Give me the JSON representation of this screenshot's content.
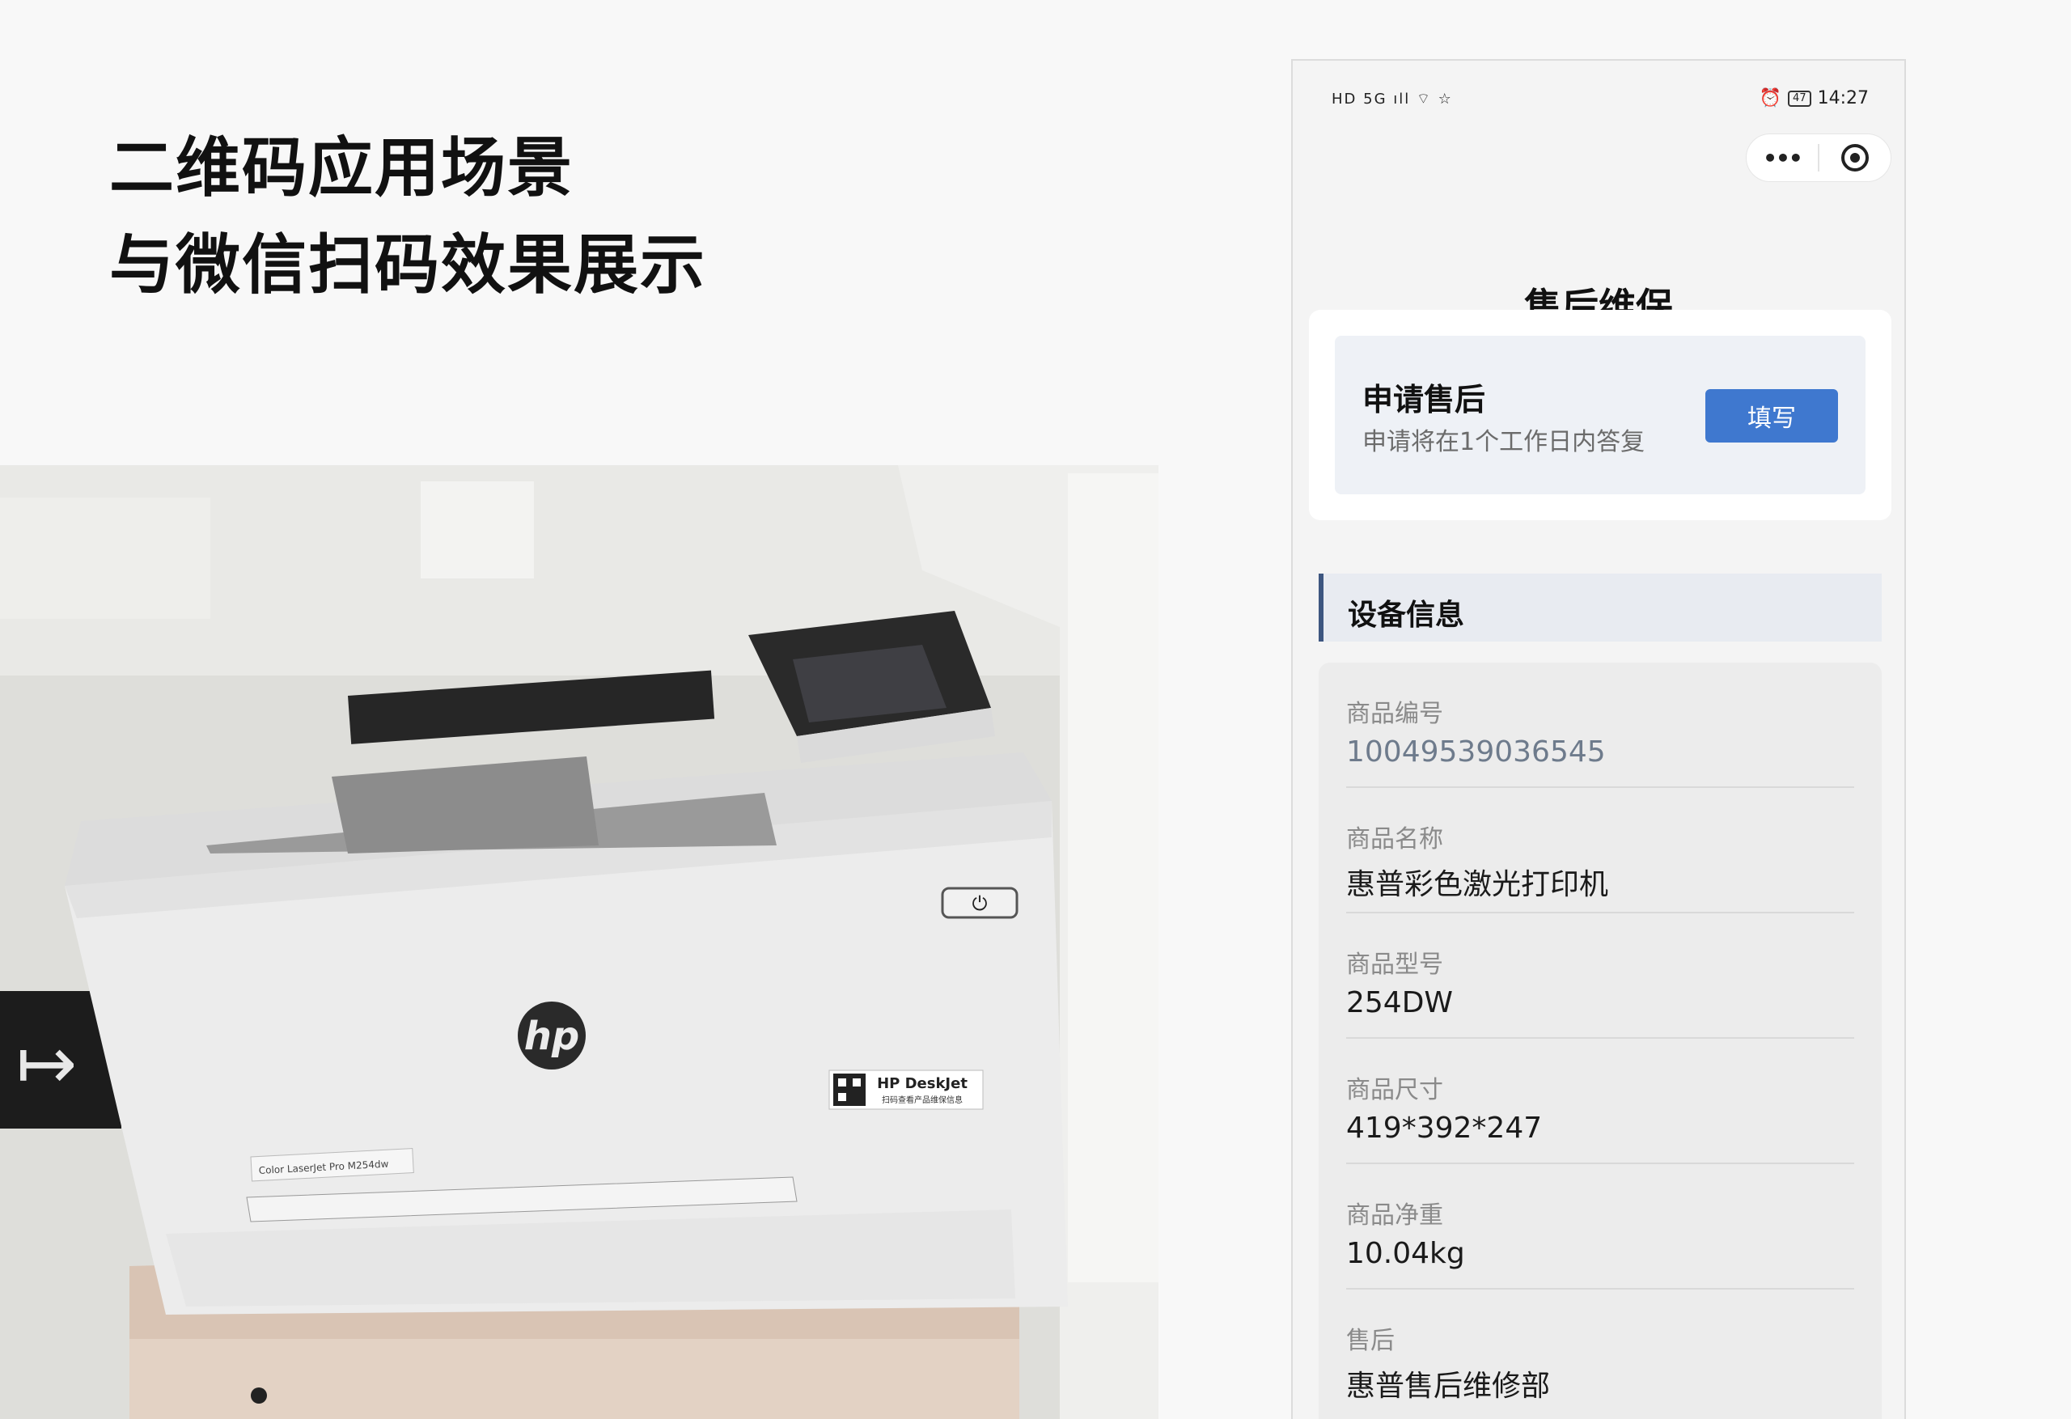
{
  "heading": {
    "line1": "二维码应用场景",
    "line2": "与微信扫码效果展示"
  },
  "photo": {
    "printer_logo": "hp",
    "qr_label_title": "HP DeskJet",
    "qr_label_sub": "扫码查看产品维保信息",
    "model_label": "Color LaserJet Pro M254dw"
  },
  "phone": {
    "status_bar": {
      "left": "HD 5G ıll ⌔ ☆",
      "battery": "47",
      "time": "14:27"
    },
    "nav_title": "售后维保",
    "service": {
      "title": "申请售后",
      "subtitle": "申请将在1个工作日内答复",
      "button_label": "填写"
    },
    "section_title": "设备信息",
    "info_rows": [
      {
        "label": "商品编号",
        "value": "10049539036545"
      },
      {
        "label": "商品名称",
        "value": "惠普彩色激光打印机"
      },
      {
        "label": "商品型号",
        "value": "254DW"
      },
      {
        "label": "商品尺寸",
        "value": "419*392*247"
      },
      {
        "label": "商品净重",
        "value": "10.04kg"
      },
      {
        "label": "售后",
        "value": "惠普售后维修部"
      }
    ],
    "accent_color": "#3f78cf"
  }
}
